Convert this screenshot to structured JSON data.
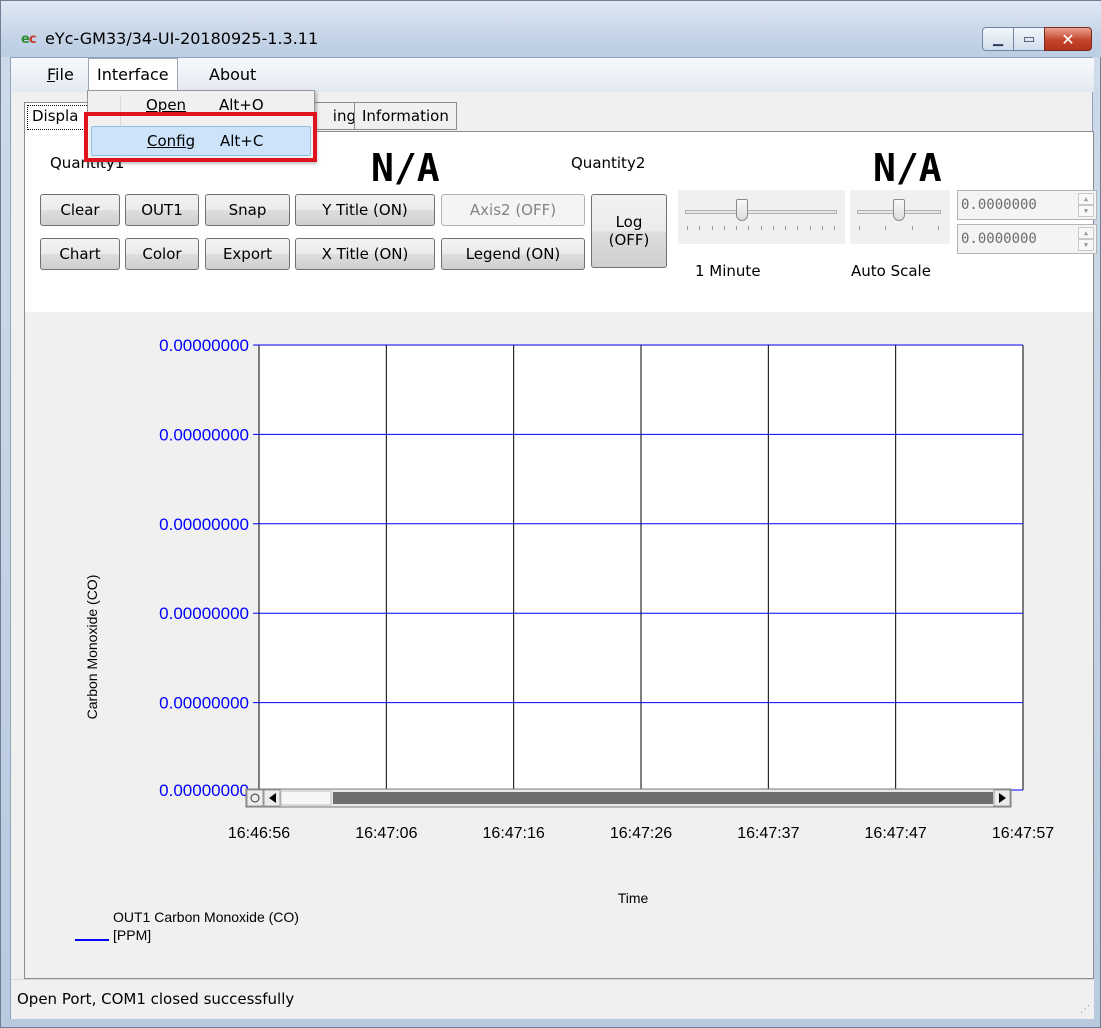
{
  "window": {
    "title": "eYc-GM33/34-UI-20180925-1.3.11",
    "icon_letters": [
      "e",
      "c"
    ],
    "buttons": [
      "minimize",
      "maximize",
      "close"
    ]
  },
  "menubar": {
    "file": "File",
    "interface": "Interface",
    "about": "About"
  },
  "dropdown": {
    "items": [
      {
        "label": "Open",
        "accelerator": "Alt+O"
      },
      {
        "label": "Config",
        "accelerator": "Alt+C"
      }
    ]
  },
  "tabs": [
    "Displa",
    "ing",
    "Information"
  ],
  "quantities": {
    "q1_label": "Quantity1",
    "q1_value": "N/A",
    "q2_label": "Quantity2",
    "q2_value": "N/A"
  },
  "toolbar": {
    "clear": "Clear",
    "out1": "OUT1",
    "snap": "Snap",
    "y_title": "Y Title (ON)",
    "axis2": "Axis2 (OFF)",
    "log_line1": "Log",
    "log_line2": "(OFF)",
    "chart": "Chart",
    "color": "Color",
    "export": "Export",
    "x_title": "X Title (ON)",
    "legend": "Legend (ON)"
  },
  "sliders": {
    "time_label": "1 Minute",
    "scale_label": "Auto Scale"
  },
  "spinners": {
    "upper": "0.0000000",
    "lower": "0.0000000"
  },
  "chart_data": {
    "type": "line",
    "xlabel": "Time",
    "ylabel": "Carbon Monoxide (CO)",
    "x_ticks": [
      "16:46:56",
      "16:47:06",
      "16:47:16",
      "16:47:26",
      "16:47:37",
      "16:47:47",
      "16:47:57"
    ],
    "y_ticks": [
      "0.00000000",
      "0.00000000",
      "0.00000000",
      "0.00000000",
      "0.00000000",
      "0.00000000"
    ],
    "series": [
      {
        "name": "OUT1 Carbon Monoxide (CO)\n[PPM]",
        "values": [],
        "color": "#0000ff"
      }
    ],
    "legend_line1": "OUT1 Carbon Monoxide (CO)",
    "legend_line2": "[PPM]",
    "grid": true,
    "legend_position": "bottom-left"
  },
  "status": {
    "text": "Open Port,   COM1 closed successfully"
  }
}
